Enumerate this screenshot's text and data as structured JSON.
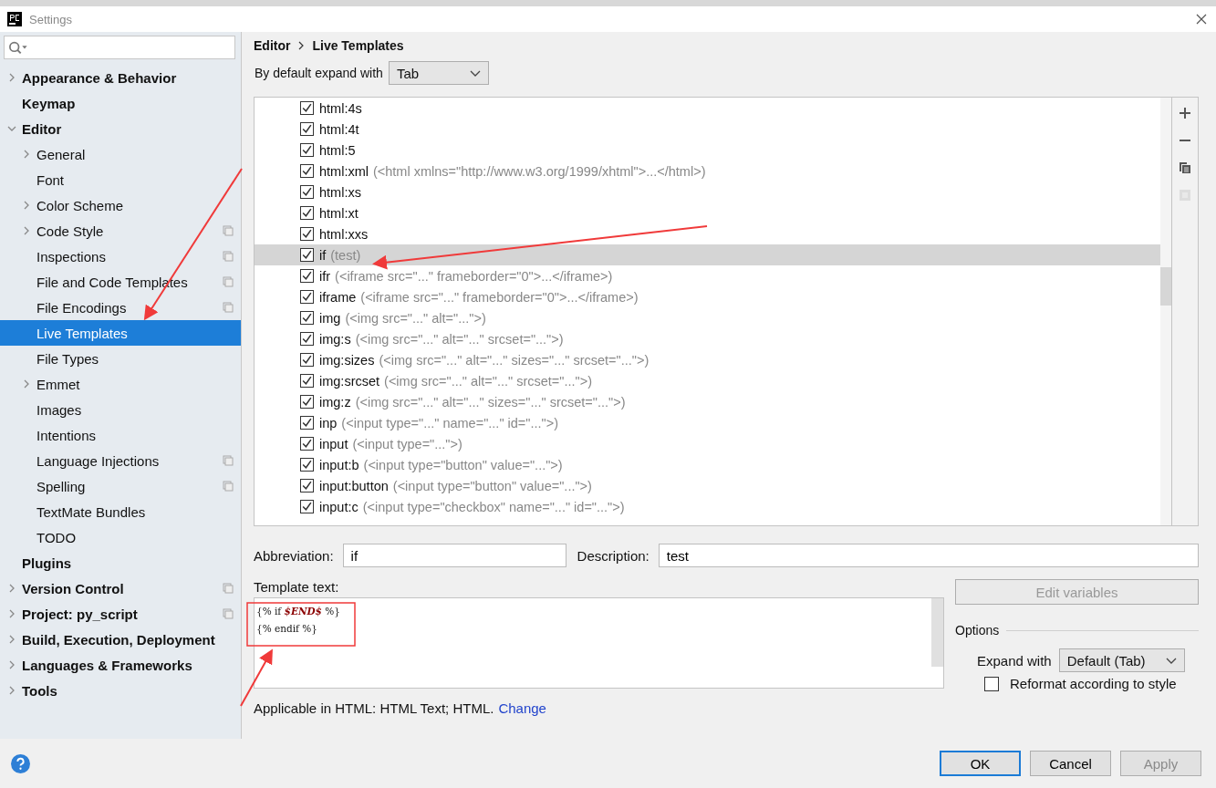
{
  "window": {
    "title": "Settings"
  },
  "sidebar": {
    "items": [
      {
        "label": "Appearance & Behavior",
        "expanded": false,
        "project_scoped": false,
        "selected": false
      },
      {
        "label": "Keymap",
        "project_scoped": false,
        "selected": false
      },
      {
        "label": "Editor",
        "expanded": true,
        "project_scoped": false,
        "selected": false,
        "children": [
          {
            "label": "General",
            "expanded": false,
            "project_scoped": false,
            "selected": false
          },
          {
            "label": "Font",
            "project_scoped": false,
            "selected": false
          },
          {
            "label": "Color Scheme",
            "expanded": false,
            "project_scoped": false,
            "selected": false
          },
          {
            "label": "Code Style",
            "expanded": false,
            "project_scoped": true,
            "selected": false
          },
          {
            "label": "Inspections",
            "project_scoped": true,
            "selected": false
          },
          {
            "label": "File and Code Templates",
            "project_scoped": true,
            "selected": false
          },
          {
            "label": "File Encodings",
            "project_scoped": true,
            "selected": false
          },
          {
            "label": "Live Templates",
            "project_scoped": false,
            "selected": true
          },
          {
            "label": "File Types",
            "project_scoped": false,
            "selected": false
          },
          {
            "label": "Emmet",
            "expanded": false,
            "project_scoped": false,
            "selected": false
          },
          {
            "label": "Images",
            "project_scoped": false,
            "selected": false
          },
          {
            "label": "Intentions",
            "project_scoped": false,
            "selected": false
          },
          {
            "label": "Language Injections",
            "project_scoped": true,
            "selected": false
          },
          {
            "label": "Spelling",
            "project_scoped": true,
            "selected": false
          },
          {
            "label": "TextMate Bundles",
            "project_scoped": false,
            "selected": false
          },
          {
            "label": "TODO",
            "project_scoped": false,
            "selected": false
          }
        ]
      },
      {
        "label": "Plugins",
        "project_scoped": false,
        "selected": false
      },
      {
        "label": "Version Control",
        "expanded": false,
        "project_scoped": true,
        "selected": false
      },
      {
        "label": "Project: py_script",
        "expanded": false,
        "project_scoped": true,
        "selected": false
      },
      {
        "label": "Build, Execution, Deployment",
        "expanded": false,
        "project_scoped": false,
        "selected": false
      },
      {
        "label": "Languages & Frameworks",
        "expanded": false,
        "project_scoped": false,
        "selected": false
      },
      {
        "label": "Tools",
        "expanded": false,
        "project_scoped": false,
        "selected": false
      }
    ]
  },
  "breadcrumb": [
    "Editor",
    "Live Templates"
  ],
  "expand_default": {
    "label": "By default expand with",
    "value": "Tab"
  },
  "templates": [
    {
      "abbreviation": "html:4s",
      "checked": true,
      "selected": false
    },
    {
      "abbreviation": "html:4t",
      "checked": true,
      "selected": false
    },
    {
      "abbreviation": "html:5",
      "checked": true,
      "selected": false
    },
    {
      "abbreviation": "html:xml",
      "description": "(<html xmlns=\"http://www.w3.org/1999/xhtml\">...</html>)",
      "checked": true,
      "selected": false
    },
    {
      "abbreviation": "html:xs",
      "checked": true,
      "selected": false
    },
    {
      "abbreviation": "html:xt",
      "checked": true,
      "selected": false
    },
    {
      "abbreviation": "html:xxs",
      "checked": true,
      "selected": false
    },
    {
      "abbreviation": "if",
      "description": "(test)",
      "checked": true,
      "selected": true
    },
    {
      "abbreviation": "ifr",
      "description": "(<iframe src=\"...\" frameborder=\"0\">...</iframe>)",
      "checked": true,
      "selected": false
    },
    {
      "abbreviation": "iframe",
      "description": "(<iframe src=\"...\" frameborder=\"0\">...</iframe>)",
      "checked": true,
      "selected": false
    },
    {
      "abbreviation": "img",
      "description": "(<img src=\"...\" alt=\"...\">)",
      "checked": true,
      "selected": false
    },
    {
      "abbreviation": "img:s",
      "description": "(<img src=\"...\" alt=\"...\" srcset=\"...\">)",
      "checked": true,
      "selected": false
    },
    {
      "abbreviation": "img:sizes",
      "description": "(<img src=\"...\" alt=\"...\" sizes=\"...\" srcset=\"...\">)",
      "checked": true,
      "selected": false
    },
    {
      "abbreviation": "img:srcset",
      "description": "(<img src=\"...\" alt=\"...\" srcset=\"...\">)",
      "checked": true,
      "selected": false
    },
    {
      "abbreviation": "img:z",
      "description": "(<img src=\"...\" alt=\"...\" sizes=\"...\" srcset=\"...\">)",
      "checked": true,
      "selected": false
    },
    {
      "abbreviation": "inp",
      "description": "(<input type=\"...\" name=\"...\" id=\"...\">)",
      "checked": true,
      "selected": false
    },
    {
      "abbreviation": "input",
      "description": "(<input type=\"...\">)",
      "checked": true,
      "selected": false
    },
    {
      "abbreviation": "input:b",
      "description": "(<input type=\"button\" value=\"...\">)",
      "checked": true,
      "selected": false
    },
    {
      "abbreviation": "input:button",
      "description": "(<input type=\"button\" value=\"...\">)",
      "checked": true,
      "selected": false
    },
    {
      "abbreviation": "input:c",
      "description": "(<input type=\"checkbox\" name=\"...\" id=\"...\">)",
      "checked": true,
      "selected": false
    }
  ],
  "abbreviation": {
    "label": "Abbreviation:",
    "value": "if"
  },
  "description": {
    "label": "Description:",
    "value": "test"
  },
  "template_text": {
    "label": "Template text:",
    "lines": [
      [
        {
          "kind": "plain",
          "text": "{% if "
        },
        {
          "kind": "variable",
          "text": "$END$"
        },
        {
          "kind": "plain",
          "text": " %}"
        }
      ],
      [
        {
          "kind": "plain",
          "text": "{% endif %}"
        }
      ]
    ]
  },
  "edit_variables": {
    "label": "Edit variables",
    "disabled": true
  },
  "options": {
    "title": "Options",
    "expand_with": {
      "label": "Expand with",
      "value": "Default (Tab)"
    },
    "reformat": {
      "label": "Reformat according to style",
      "checked": false
    }
  },
  "applicable": {
    "text": "Applicable in HTML: HTML Text; HTML.",
    "link": "Change"
  },
  "buttons": [
    {
      "label": "OK",
      "default": true,
      "disabled": false
    },
    {
      "label": "Cancel",
      "default": false,
      "disabled": false
    },
    {
      "label": "Apply",
      "default": false,
      "disabled": true
    }
  ]
}
